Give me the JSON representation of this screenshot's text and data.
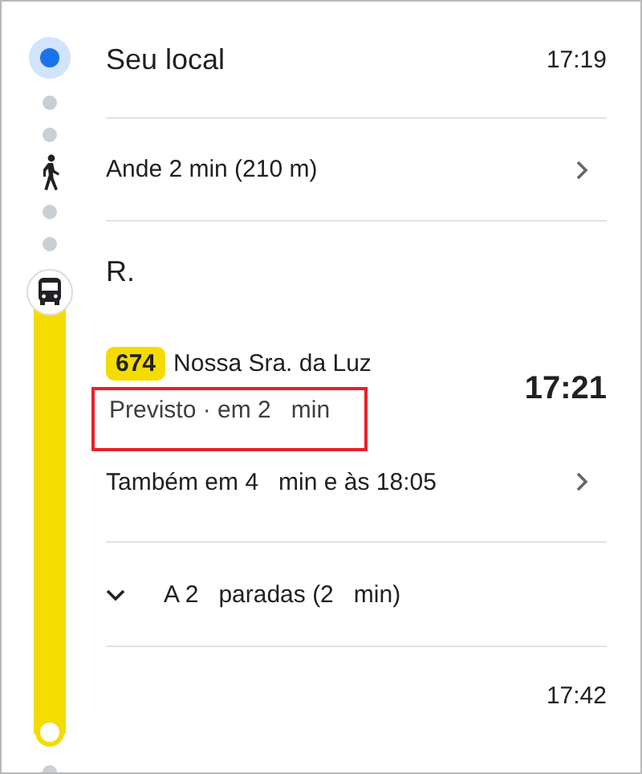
{
  "origin": {
    "title": "Seu local",
    "time": "17:19"
  },
  "walk": {
    "text": "Ande 2 min (210 m)"
  },
  "stop": {
    "title": "R."
  },
  "transit": {
    "route": "674",
    "headsign": "Nossa Sra. da Luz",
    "time": "17:21",
    "status_line": "Previsto · em 2   min",
    "highlighted": true,
    "also": "Também em 4   min e às 18:05"
  },
  "stops": {
    "text": "A 2   paradas (2   min)",
    "expanded": false
  },
  "arrival": {
    "time": "17:42"
  }
}
